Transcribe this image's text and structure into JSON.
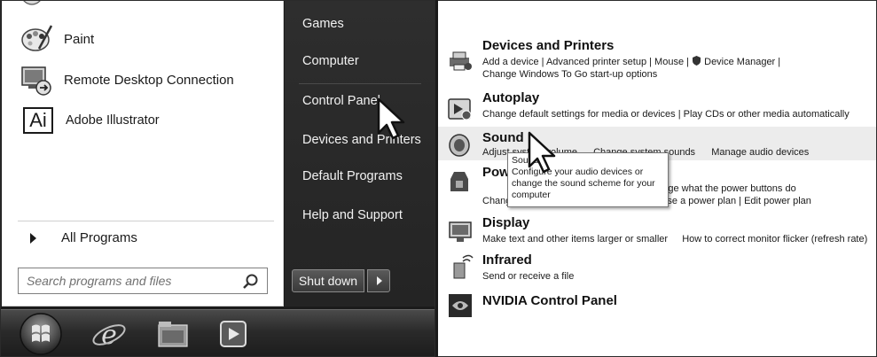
{
  "start_menu": {
    "programs": [
      {
        "label": "Paint",
        "icon": "paint-icon"
      },
      {
        "label": "Remote Desktop Connection",
        "icon": "remote-desktop-icon"
      },
      {
        "label": "Adobe Illustrator",
        "icon": "illustrator-icon",
        "icon_text": "Ai"
      }
    ],
    "all_programs": "All Programs",
    "search_placeholder": "Search programs and files",
    "right_links": [
      "Games",
      "Computer",
      "Control Panel",
      "Devices and Printers",
      "Default Programs",
      "Help and Support"
    ],
    "shutdown_label": "Shut down"
  },
  "taskbar": {
    "items": [
      "start-orb-icon",
      "internet-explorer-icon",
      "windows-explorer-icon",
      "media-player-icon"
    ]
  },
  "control_panel": {
    "categories": [
      {
        "title": "Devices and Printers",
        "lines": [
          "Add a device  |  Advanced printer setup  |  Mouse   |",
          "Device Manager  |",
          "Change Windows To Go start-up options"
        ],
        "icon": "devices-printers-icon"
      },
      {
        "title": "Autoplay",
        "lines": [
          "Change default settings for media or devices | Play CDs or other media automatically"
        ],
        "icon": "autoplay-icon"
      },
      {
        "title": "Sound",
        "lines": [
          "Adjust system volume",
          "Change system sounds",
          "Manage audio devices"
        ],
        "icon": "speaker-icon"
      },
      {
        "title": "Power Options",
        "lines": [
          "Change what the power buttons do",
          "Change when the computer sleeps",
          "Choose a power plan",
          "Edit power plan"
        ],
        "icon": "power-icon"
      },
      {
        "title": "Display",
        "lines": [
          "Make text and other items larger or smaller",
          "How to correct monitor flicker (refresh rate)"
        ],
        "icon": "display-icon"
      },
      {
        "title": "Infrared",
        "lines": [
          "Send or receive a file"
        ],
        "icon": "infrared-icon"
      },
      {
        "title": "NVIDIA Control Panel",
        "lines": [],
        "icon": "nvidia-icon"
      }
    ],
    "tooltip": {
      "title": "Sound",
      "text": "Configure your audio devices or change the sound scheme for your computer"
    }
  }
}
